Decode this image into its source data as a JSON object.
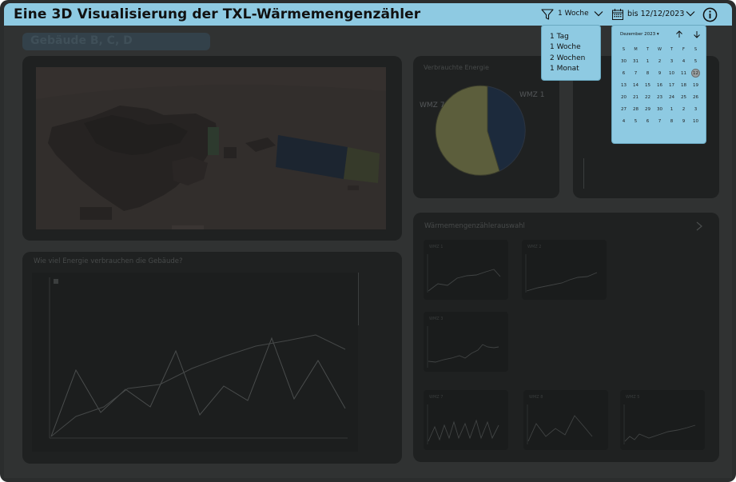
{
  "header": {
    "title": "Eine 3D Visualisierung der TXL-Wärmemengenzähler",
    "filter_label": "1 Woche",
    "date_label": "bis 12/12/2023"
  },
  "subtitle": "Gebäude B, C, D",
  "energy_card": {
    "title": "Verbrauchte Energie",
    "labels": [
      "WMZ 7",
      "WMZ 1"
    ]
  },
  "usage_chart": {
    "title": "Wie viel Energie verbrauchen die Gebäude?"
  },
  "selector_card": {
    "title": "Wärmemengenzählerauswahl",
    "meters": [
      "WMZ 1",
      "WMZ 2",
      "WMZ 3",
      "WMZ 7",
      "WMZ 8",
      "WMZ 5"
    ]
  },
  "dropdown": {
    "options": [
      "1 Tag",
      "1 Woche",
      "2 Wochen",
      "1 Monat"
    ]
  },
  "calendar": {
    "month_label": "Dezember 2023",
    "weekdays": [
      "S",
      "M",
      "T",
      "W",
      "T",
      "F",
      "S"
    ],
    "weeks": [
      [
        "30",
        "31",
        "1",
        "2",
        "3",
        "4",
        "5"
      ],
      [
        "6",
        "7",
        "8",
        "9",
        "10",
        "11",
        "12"
      ],
      [
        "13",
        "14",
        "15",
        "16",
        "17",
        "18",
        "19"
      ],
      [
        "20",
        "21",
        "22",
        "23",
        "24",
        "25",
        "26"
      ],
      [
        "27",
        "28",
        "29",
        "30",
        "1",
        "2",
        "3"
      ],
      [
        "4",
        "5",
        "6",
        "7",
        "8",
        "9",
        "10"
      ]
    ],
    "selected": "12"
  },
  "colors": {
    "accent": "#8ecae2",
    "pie_wmz7": "#5c5e3c",
    "pie_wmz1": "#1c2a3c"
  }
}
